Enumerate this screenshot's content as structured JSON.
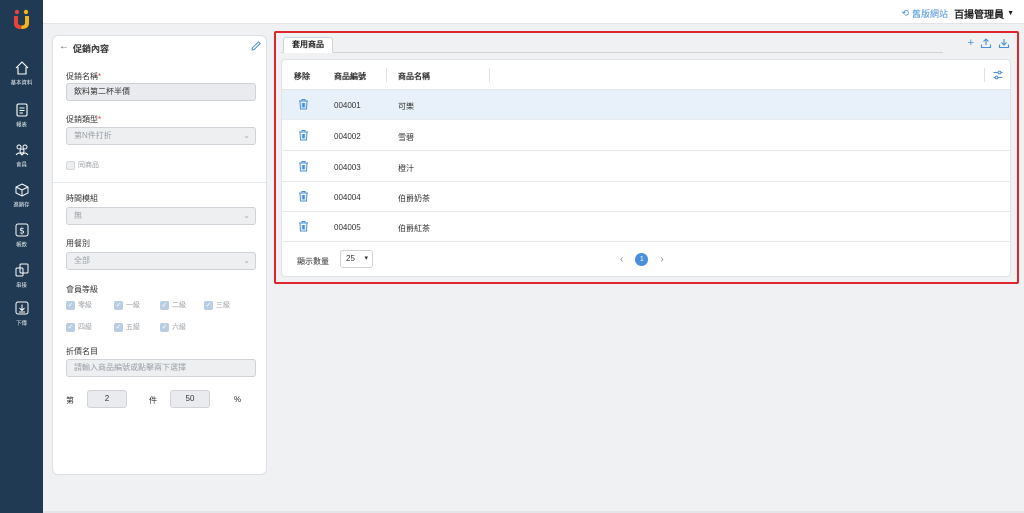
{
  "nav": {
    "items": [
      {
        "label": "基本資料",
        "icon": "home-icon"
      },
      {
        "label": "報表",
        "icon": "report-icon"
      },
      {
        "label": "會員",
        "icon": "members-icon"
      },
      {
        "label": "進銷存",
        "icon": "inventory-icon"
      },
      {
        "label": "帳款",
        "icon": "dollar-icon"
      },
      {
        "label": "串接",
        "icon": "connect-icon"
      },
      {
        "label": "下傳",
        "icon": "download-icon"
      }
    ]
  },
  "topbar": {
    "old_site": "舊版網站",
    "user": "百揚管理員"
  },
  "promo": {
    "header": "促銷內容",
    "name_label": "促銷名稱",
    "name_value": "飲料第二杯半價",
    "type_label": "促銷類型",
    "type_value": "第N件打折",
    "same_product": "同商品",
    "time_label": "時間模組",
    "time_value": "無",
    "meal_label": "用餐別",
    "meal_value": "全部",
    "member_label": "會員等級",
    "levels": [
      "零級",
      "一級",
      "二級",
      "三級",
      "四級",
      "五級",
      "六級"
    ],
    "discount_label": "折價名目",
    "discount_placeholder": "請輸入商品編號或點擊兩下選擇",
    "nth_prefix": "第",
    "nth_value": "2",
    "nth_unit": "件",
    "percent_value": "50",
    "percent_unit": "%"
  },
  "products": {
    "tab": "套用商品",
    "columns": {
      "remove": "移除",
      "code": "商品編號",
      "name": "商品名稱"
    },
    "rows": [
      {
        "code": "004001",
        "name": "可樂"
      },
      {
        "code": "004002",
        "name": "雪碧"
      },
      {
        "code": "004003",
        "name": "橙汁"
      },
      {
        "code": "004004",
        "name": "伯爵奶茶"
      },
      {
        "code": "004005",
        "name": "伯爵紅茶"
      }
    ],
    "page_size_label": "顯示數量",
    "page_size": "25",
    "current_page": "1"
  },
  "colors": {
    "nav": "#1f3a52",
    "accent": "#4a90d9",
    "highlight": "#e1252e"
  }
}
